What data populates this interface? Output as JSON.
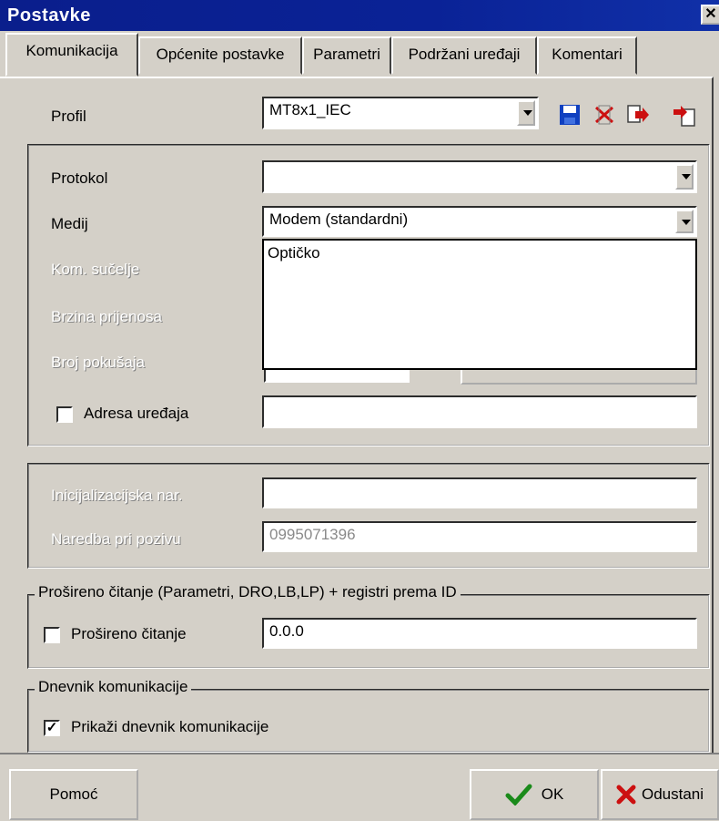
{
  "window": {
    "title": "Postavke",
    "close_icon": "close-icon"
  },
  "tabs": [
    {
      "label": "Komunikacija",
      "active": true
    },
    {
      "label": "Općenite postavke",
      "active": false
    },
    {
      "label": "Parametri",
      "active": false
    },
    {
      "label": "Podržani uređaji",
      "active": false
    },
    {
      "label": "Komentari",
      "active": false
    }
  ],
  "profile": {
    "label": "Profil",
    "value": "MT8x1_IEC",
    "icons": [
      "save-icon",
      "delete-icon",
      "export-icon",
      "import-icon"
    ]
  },
  "connection": {
    "protocol_label": "Protokol",
    "protocol_value": "",
    "medium_label": "Medij",
    "medium_value": "Modem (standardni)",
    "medium_options_visible": [
      "Optičko"
    ],
    "port_label": "Kom. sučelje",
    "baud_label": "Brzina prijenosa",
    "retries_label": "Broj pokušaja",
    "device_address_label": "Adresa uređaja",
    "device_address_checked": false,
    "device_address_value": ""
  },
  "modem": {
    "init_label": "Inicijalizacijska nar.",
    "init_value": "",
    "dial_label": "Naredba pri pozivu",
    "dial_value": "0995071396"
  },
  "extended": {
    "group_label": "Prošireno čitanje (Parametri, DRO,LB,LP) + registri prema ID",
    "checkbox_label": "Prošireno čitanje",
    "checked": false,
    "value": "0.0.0"
  },
  "log": {
    "group_label": "Dnevnik komunikacije",
    "checkbox_label": "Prikaži dnevnik komunikacije",
    "checked": true
  },
  "buttons": {
    "help": "Pomoć",
    "ok": "OK",
    "cancel": "Odustani"
  },
  "colors": {
    "titlebar": "#0a2296",
    "ok_check": "#1a8a1a",
    "cancel_x": "#cc1010",
    "save_icon": "#1040c0",
    "delete_icon": "#cc1010"
  }
}
